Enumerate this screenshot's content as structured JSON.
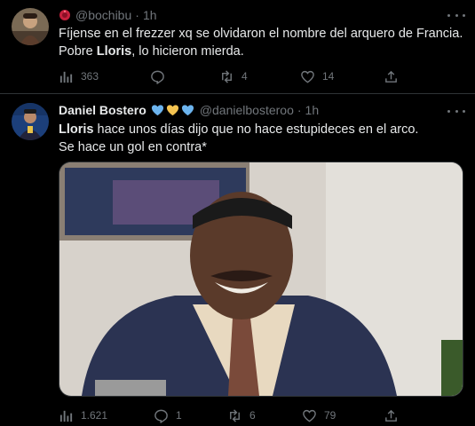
{
  "tweet1": {
    "handle": "@bochibu",
    "sep": "·",
    "time": "1h",
    "text_a": "Fíjense en el frezzer xq se olvidaron el nombre del arquero de Francia.",
    "text_b": "Pobre ",
    "text_bold": "Lloris",
    "text_c": ", lo hicieron mierda.",
    "views": "363",
    "replies": "",
    "retweets": "4",
    "likes": "14"
  },
  "tweet2": {
    "name": "Daniel Bostero",
    "handle": "@danielbosteroo",
    "sep": "·",
    "time": "1h",
    "text_bold": "Lloris",
    "text_a": " hace unos días dijo que no  hace estupideces en el arco.",
    "text_b": "Se hace un gol en contra*",
    "views": "1.621",
    "replies": "1",
    "retweets": "6",
    "likes": "79"
  },
  "colors": {
    "background": "#000000",
    "text": "#e7e9ea",
    "muted": "#71767b",
    "divider": "#2f3336",
    "heart_blue": "#6cb4ee",
    "heart_yellow": "#f5c451"
  },
  "icons": [
    "more-icon",
    "views-icon",
    "reply-icon",
    "retweet-icon",
    "like-icon",
    "share-icon",
    "heart-emoji"
  ]
}
